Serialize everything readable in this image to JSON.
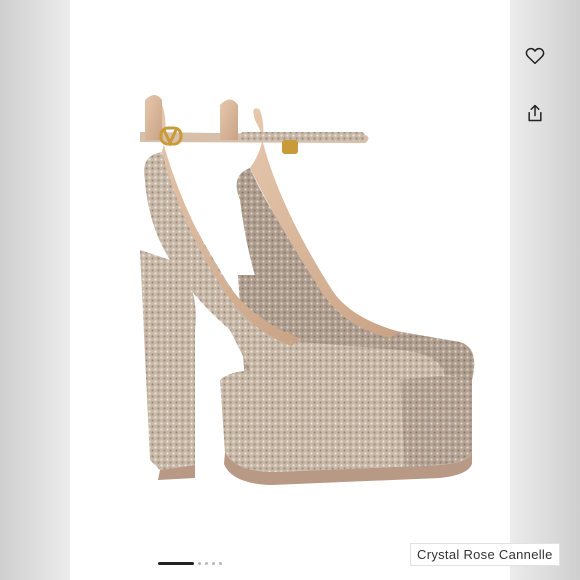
{
  "caption": "Crystal Rose Cannelle",
  "icons": {
    "like": "heart-icon",
    "share": "share-icon"
  },
  "carousel": {
    "total": 6,
    "active_index": 0
  },
  "colors": {
    "shoe_primary": "#c9b9aa",
    "shoe_shade": "#a99888",
    "sole": "#b79985",
    "strap": "#d8bfa9",
    "buckle": "#c89a3a",
    "background": "#ffffff"
  }
}
